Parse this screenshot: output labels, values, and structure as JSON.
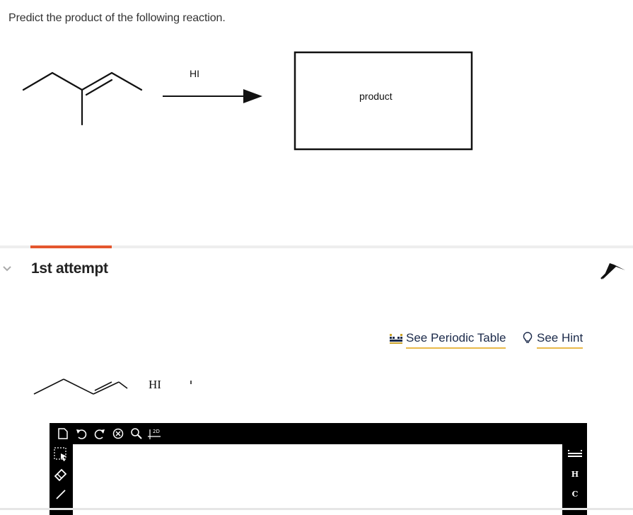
{
  "question": {
    "text": "Predict the product of the following reaction."
  },
  "scheme": {
    "reagent": "HI",
    "product_label": "product"
  },
  "attempt": {
    "title": "1st attempt"
  },
  "links": {
    "periodic_table": "See Periodic Table",
    "hint": "See Hint"
  },
  "mini_scheme": {
    "reagent": "HI"
  },
  "editor": {
    "toolbar": [
      "new-document-icon",
      "undo-icon",
      "redo-icon",
      "clear-icon",
      "zoom-icon",
      "2d-clean-icon"
    ],
    "left_tools": [
      "selection-icon",
      "eraser-icon",
      "bond-icon"
    ],
    "elements": [
      "H",
      "C"
    ]
  },
  "colors": {
    "accent": "#e4572e",
    "link_underline": "#e9b949",
    "editor_bg": "#000000"
  }
}
